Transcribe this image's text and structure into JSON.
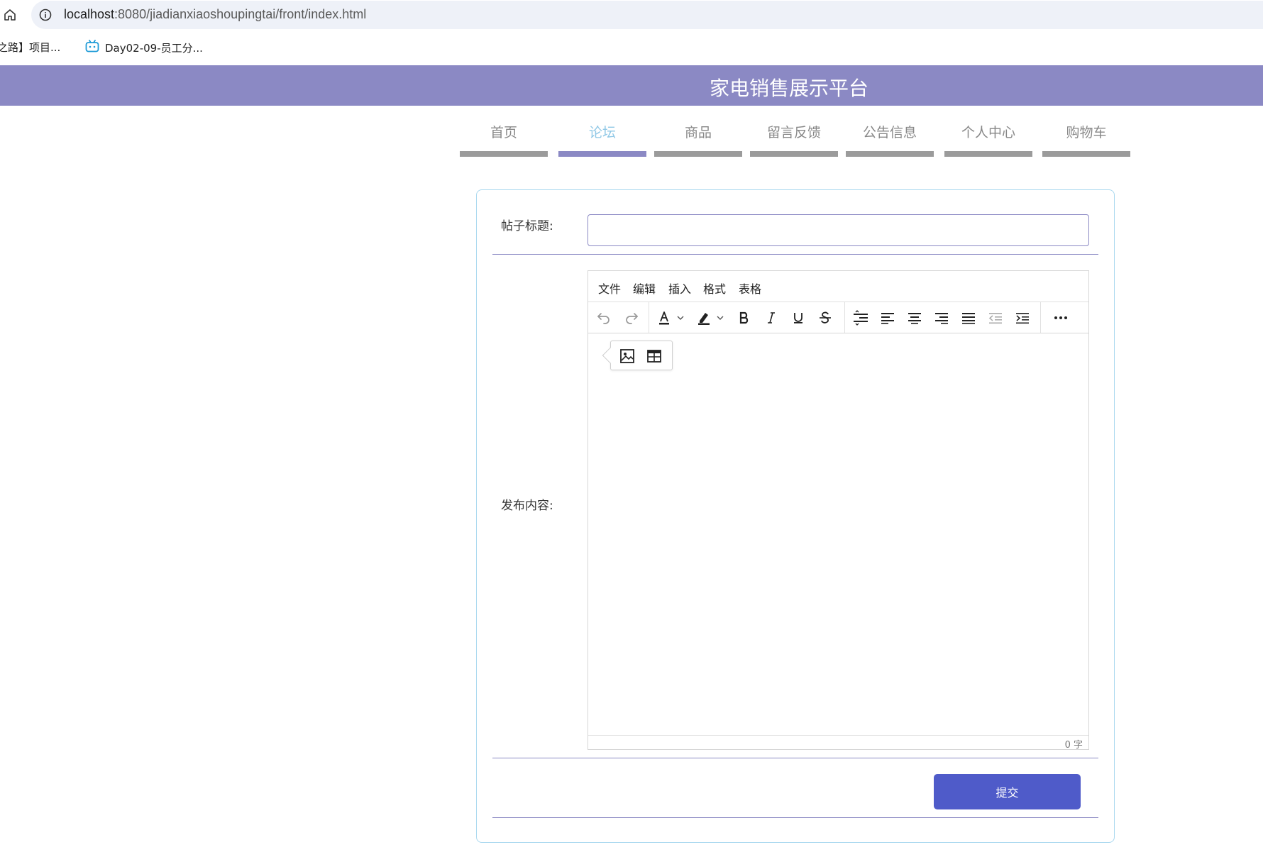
{
  "browser": {
    "url_host": "localhost",
    "url_path": ":8080/jiadianxiaoshoupingtai/front/index.html",
    "bookmarks": [
      {
        "label": "之路】项目..."
      },
      {
        "label": "Day02-09-员工分..."
      }
    ]
  },
  "site": {
    "title": "家电销售展示平台",
    "header_color": "#8b89c4",
    "accent_color": "#4f5bc9"
  },
  "nav": {
    "items": [
      {
        "label": "首页"
      },
      {
        "label": "论坛"
      },
      {
        "label": "商品"
      },
      {
        "label": "留言反馈"
      },
      {
        "label": "公告信息"
      },
      {
        "label": "个人中心"
      },
      {
        "label": "购物车"
      }
    ],
    "active": "论坛"
  },
  "form": {
    "title_label": "帖子标题:",
    "title_value": "",
    "content_label": "发布内容:",
    "submit_label": "提交"
  },
  "editor": {
    "menu": [
      "文件",
      "编辑",
      "插入",
      "格式",
      "表格"
    ],
    "toolbar_icons": [
      "undo-icon",
      "redo-icon",
      "text-color-icon",
      "highlight-icon",
      "bold-icon",
      "italic-icon",
      "underline-icon",
      "strikethrough-icon",
      "line-height-icon",
      "align-left-icon",
      "align-center-icon",
      "align-right-icon",
      "align-justify-icon",
      "outdent-icon",
      "indent-icon",
      "more-icon"
    ],
    "quick_insert_icons": [
      "image-icon",
      "table-icon"
    ],
    "word_count": "0 字"
  }
}
